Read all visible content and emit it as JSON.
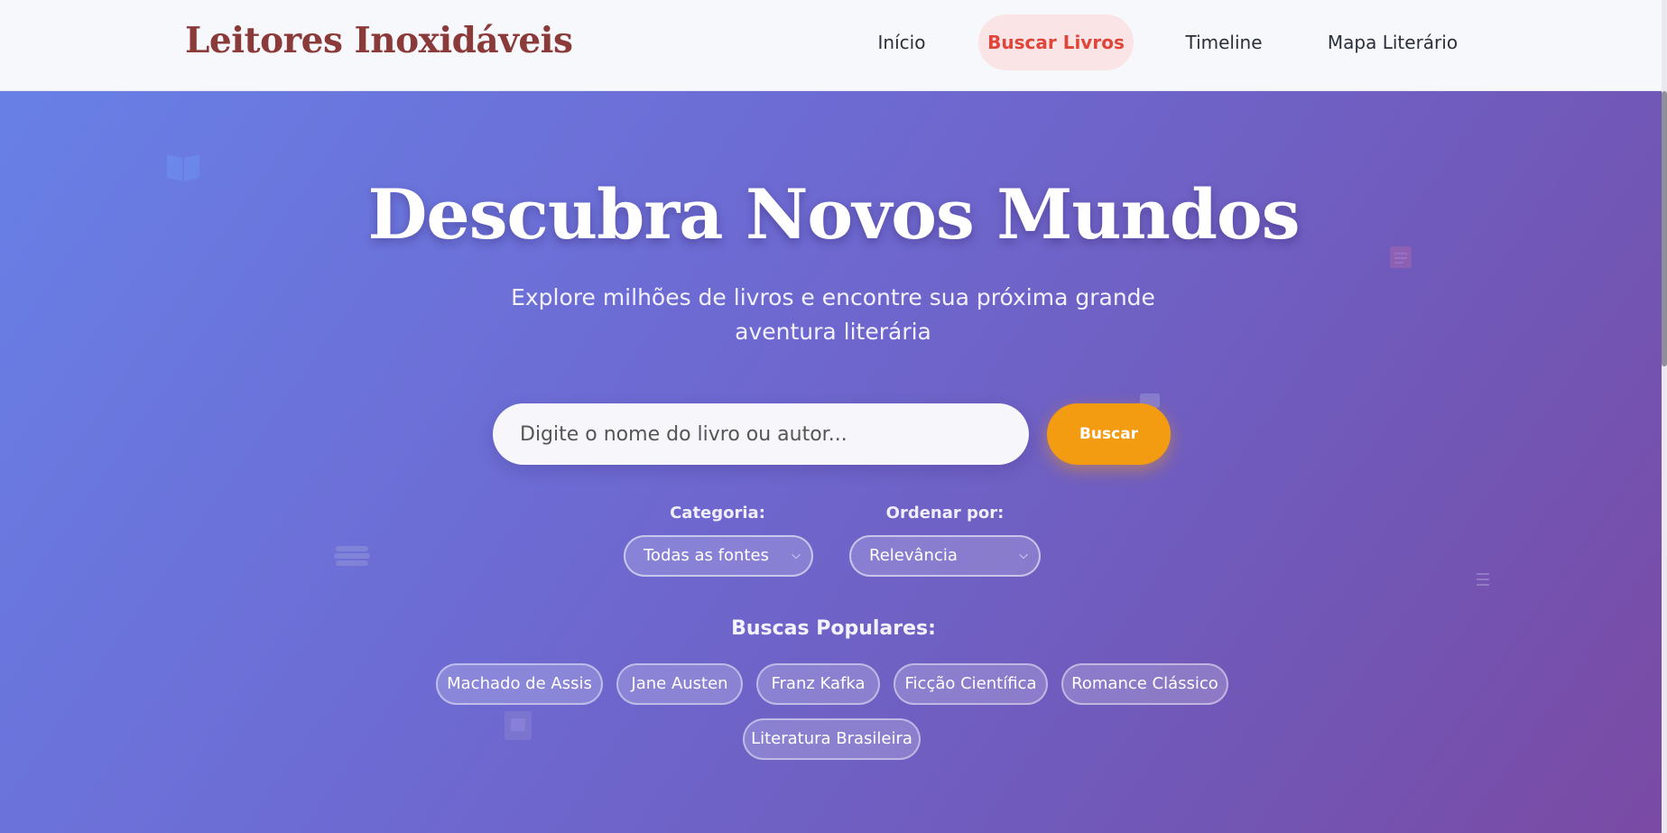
{
  "header": {
    "brand": "Leitores Inoxidáveis",
    "nav": [
      {
        "label": "Início",
        "active": false
      },
      {
        "label": "Buscar Livros",
        "active": true
      },
      {
        "label": "Timeline",
        "active": false
      },
      {
        "label": "Mapa Literário",
        "active": false
      }
    ]
  },
  "hero": {
    "title": "Descubra Novos Mundos",
    "subtitle": "Explore milhões de livros e encontre sua próxima grande aventura literária"
  },
  "search": {
    "placeholder": "Digite o nome do livro ou autor...",
    "value": "",
    "button_label": "Buscar"
  },
  "filters": {
    "category_label": "Categoria:",
    "category_value": "Todas as fontes",
    "sort_label": "Ordenar por:",
    "sort_value": "Relevância"
  },
  "popular": {
    "title": "Buscas Populares:",
    "chips": [
      "Machado de Assis",
      "Jane Austen",
      "Franz Kafka",
      "Ficção Científica",
      "Romance Clássico",
      "Literatura Brasileira"
    ]
  },
  "colors": {
    "accent": "#f39c12",
    "brand": "#8b3a3a",
    "nav_active_bg": "#fae4e6",
    "nav_active_text": "#e0453a",
    "hero_gradient_start": "#6880e6",
    "hero_gradient_end": "#7a4aa4"
  },
  "icons": {
    "deco_1": "open-book-icon",
    "deco_2": "document-icon",
    "deco_3": "stack-of-books-icon",
    "deco_4": "notes-icon",
    "deco_5": "frame-icon",
    "deco_6": "card-icon",
    "select_chevron": "chevron-down-icon"
  }
}
